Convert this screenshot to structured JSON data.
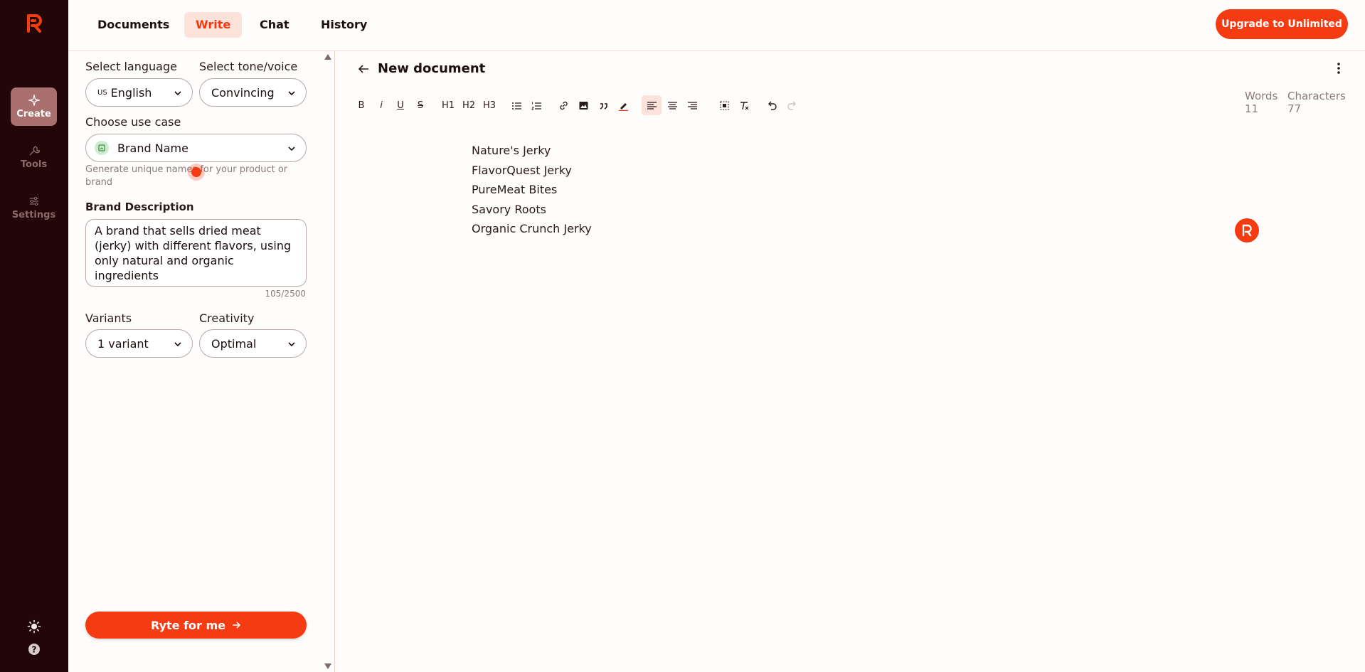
{
  "nav": {
    "rail": [
      {
        "label": "Create",
        "icon": "sparkle-icon"
      },
      {
        "label": "Tools",
        "icon": "wrench-icon"
      },
      {
        "label": "Settings",
        "icon": "sliders-icon"
      }
    ],
    "tabs": [
      "Documents",
      "Write",
      "Chat",
      "History"
    ],
    "active_tab": "Write",
    "upgrade_label": "Upgrade to Unlimited"
  },
  "form": {
    "language_label": "Select language",
    "language_flag": "US",
    "language_value": "English",
    "tone_label": "Select tone/voice",
    "tone_value": "Convincing",
    "usecase_label": "Choose use case",
    "usecase_value": "Brand Name",
    "usecase_hint": "Generate unique names for your product or brand",
    "description_label": "Brand Description",
    "description_value": "A brand that sells dried meat (jerky) with different flavors, using only natural and organic ingredients",
    "description_count": "105/2500",
    "variants_label": "Variants",
    "variants_value": "1 variant",
    "creativity_label": "Creativity",
    "creativity_value": "Optimal",
    "submit_label": "Ryte for me"
  },
  "editor": {
    "title": "New document",
    "toolbar": {
      "bold": "B",
      "italic": "i",
      "underline": "U",
      "strike": "S",
      "h1": "H1",
      "h2": "H2",
      "h3": "H3"
    },
    "stats": {
      "words_label": "Words",
      "words_value": "11",
      "chars_label": "Characters",
      "chars_value": "77"
    },
    "lines": [
      "Nature's Jerky",
      "FlavorQuest Jerky",
      "PureMeat Bites",
      "Savory Roots",
      "Organic Crunch Jerky"
    ]
  },
  "colors": {
    "accent": "#f43b12",
    "rail_bg": "#220608",
    "active_tab_bg": "#fde2dc"
  }
}
